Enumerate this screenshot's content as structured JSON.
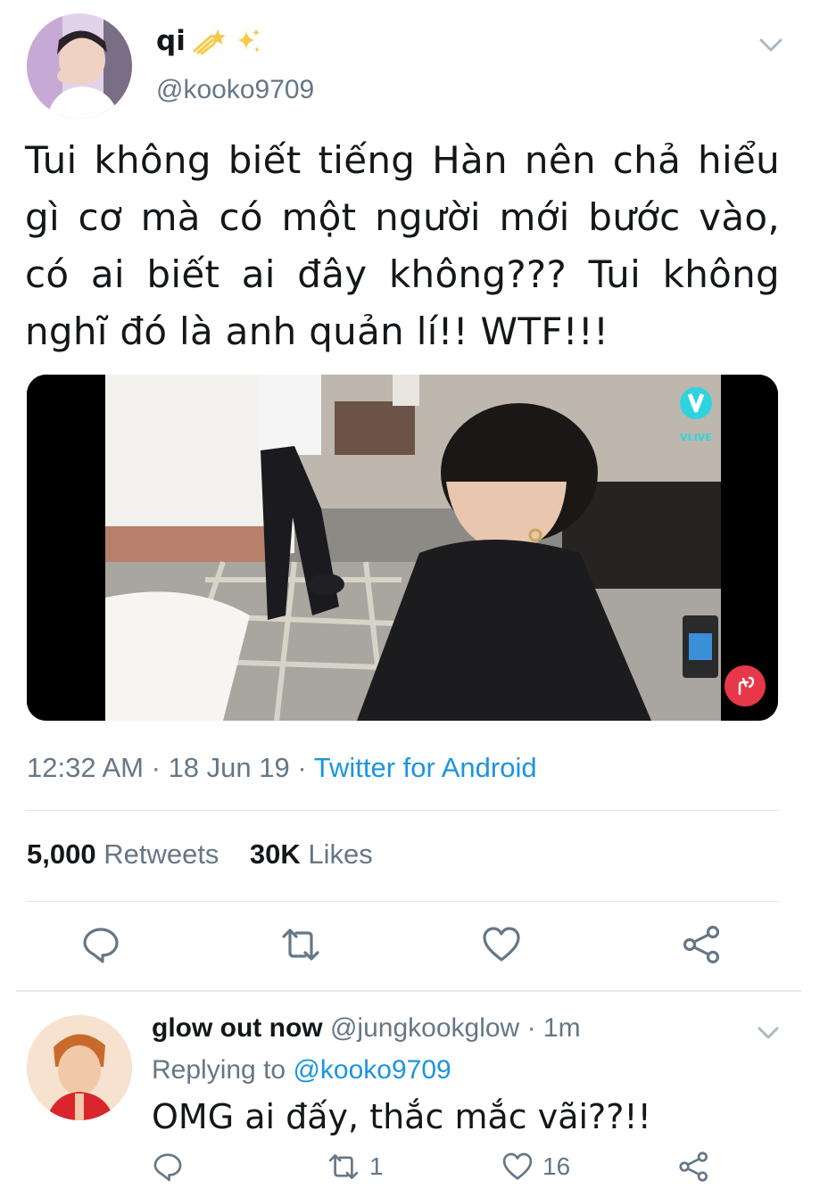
{
  "tweet": {
    "display_name": "qi",
    "name_emojis": [
      "shooting-star-emoji",
      "sparkles-emoji"
    ],
    "handle": "@kooko9709",
    "text": "Tui không biết tiếng Hàn nên chả hiểu gì cơ mà có một người mới bước vào, có ai biết ai đây không??? Tui không nghĩ đó là anh quản lí!! WTF!!!",
    "media": {
      "badge_label": "VLIVE"
    },
    "time": "12:32 AM",
    "date": "18 Jun 19",
    "source": "Twitter for Android",
    "sep": "·",
    "retweets_count": "5,000",
    "retweets_label": "Retweets",
    "likes_count": "30K",
    "likes_label": "Likes",
    "actions": [
      "reply-icon",
      "retweet-icon",
      "like-icon",
      "share-icon"
    ]
  },
  "reply": {
    "display_name": "glow out now",
    "handle": "@jungkookglow",
    "age": "· 1m",
    "replying_label": "Replying to",
    "replying_handle": "@kooko9709",
    "text": "OMG ai đấy, thắc mắc vãi??!!",
    "retweet_count": "1",
    "like_count": "16"
  },
  "colors": {
    "link": "#1b95e0",
    "secondary": "#657786",
    "divider": "#e1e8ed",
    "like_button": "#e7384a"
  }
}
